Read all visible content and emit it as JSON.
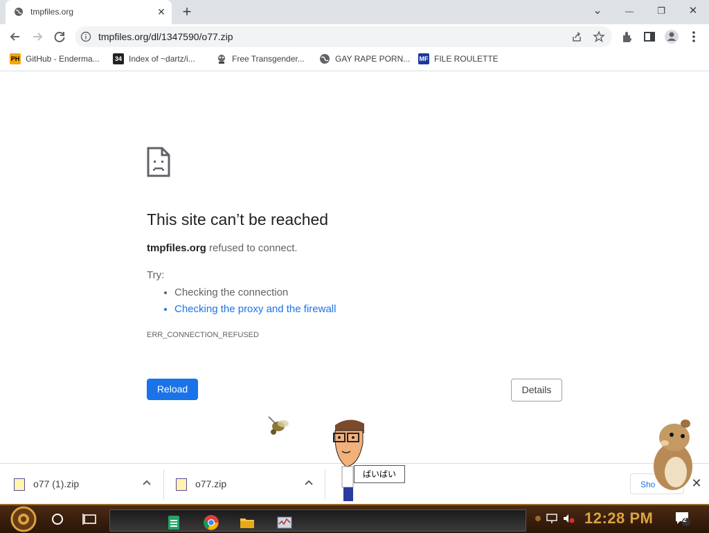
{
  "tab": {
    "title": "tmpfiles.org",
    "close": "✕"
  },
  "window_controls": {
    "minimize": "—",
    "restore": "❐",
    "close": "✕",
    "tabsearch": "⌄"
  },
  "toolbar": {
    "url": "tmpfiles.org/dl/1347590/o77.zip"
  },
  "bookmarks": [
    {
      "label": "GitHub - Enderma...",
      "icon": "PH",
      "icon_bg": "#f7a600",
      "icon_fg": "#000"
    },
    {
      "label": "Index of ~dartz/i...",
      "icon": "34",
      "icon_bg": "#222",
      "icon_fg": "#fff"
    },
    {
      "label": "Free Transgender...",
      "icon": "",
      "icon_bg": "#555",
      "icon_fg": "#fff"
    },
    {
      "label": "GAY RAPE PORN...",
      "icon": "",
      "icon_bg": "#666",
      "icon_fg": "#fff"
    },
    {
      "label": "FILE ROULETTE",
      "icon": "MF",
      "icon_bg": "#1a3aa0",
      "icon_fg": "#fff"
    }
  ],
  "error": {
    "title": "This site can’t be reached",
    "host": "tmpfiles.org",
    "message": " refused to connect.",
    "try_label": "Try:",
    "suggestions": [
      "Checking the connection",
      "Checking the proxy and the firewall"
    ],
    "code": "ERR_CONNECTION_REFUSED",
    "reload_label": "Reload",
    "details_label": "Details"
  },
  "downloads": {
    "items": [
      {
        "name": "o77 (1).zip"
      },
      {
        "name": "o77.zip"
      }
    ],
    "show_all_label": "Sho",
    "close": "✕"
  },
  "speech_bubble": "ばいばい",
  "taskbar": {
    "time": "12:28 PM",
    "notifications": "2"
  },
  "colors": {
    "accent": "#1a73e8",
    "clock": "#d9a441"
  }
}
